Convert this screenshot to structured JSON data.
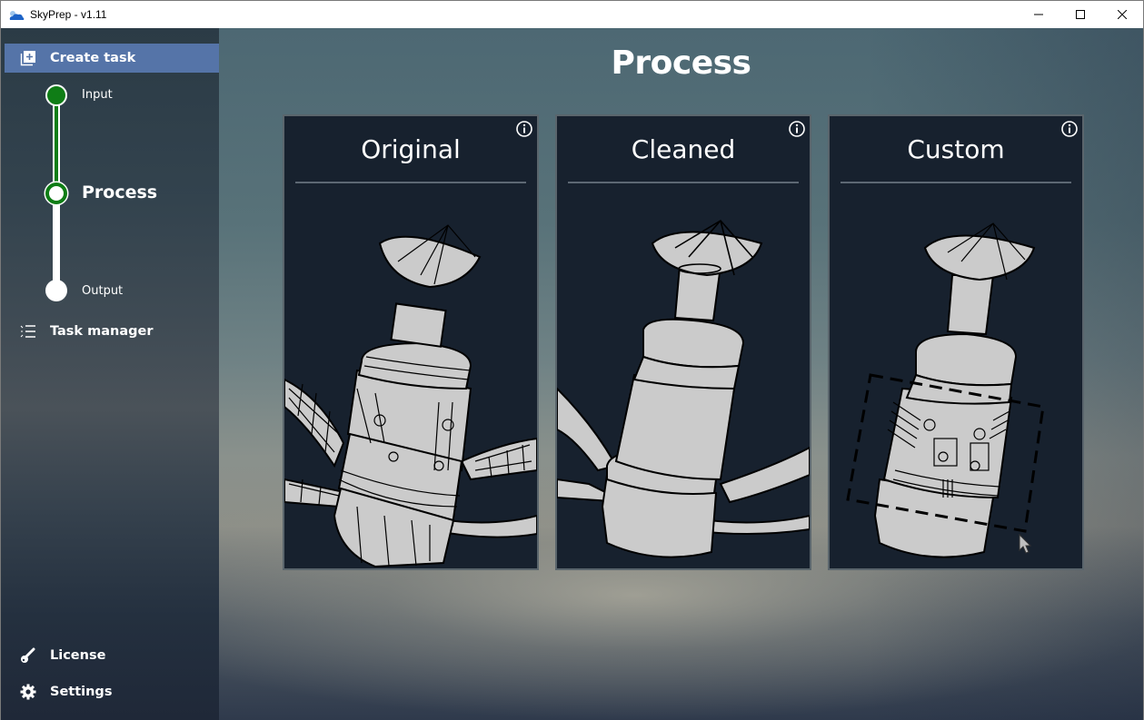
{
  "window": {
    "title": "SkyPrep - v1.11",
    "app_icon": "cloud-icon",
    "controls": [
      {
        "name": "minimize",
        "icon": "minimize-icon"
      },
      {
        "name": "maximize",
        "icon": "maximize-icon"
      },
      {
        "name": "close",
        "icon": "close-icon"
      }
    ]
  },
  "sidebar": {
    "create_task": {
      "label": "Create task",
      "icon": "add-square-icon",
      "active": true
    },
    "steps": [
      {
        "label": "Input",
        "state": "completed"
      },
      {
        "label": "Process",
        "state": "current"
      },
      {
        "label": "Output",
        "state": "pending"
      }
    ],
    "task_manager": {
      "label": "Task manager",
      "icon": "checklist-icon"
    },
    "license": {
      "label": "License",
      "icon": "key-icon"
    },
    "settings": {
      "label": "Settings",
      "icon": "gear-icon"
    }
  },
  "main": {
    "title": "Process",
    "cards": [
      {
        "title": "Original",
        "info_icon": "info-icon",
        "image": "satellite-original-detailed"
      },
      {
        "title": "Cleaned",
        "info_icon": "info-icon",
        "image": "satellite-cleaned-simplified"
      },
      {
        "title": "Custom",
        "info_icon": "info-icon",
        "image": "satellite-custom-selection"
      }
    ]
  },
  "colors": {
    "accent_active": "#5574a8",
    "step_complete": "#0f7d16",
    "card_bg": "#17212e",
    "card_border": "#5a656c",
    "model_fill": "#cbcbcb"
  }
}
